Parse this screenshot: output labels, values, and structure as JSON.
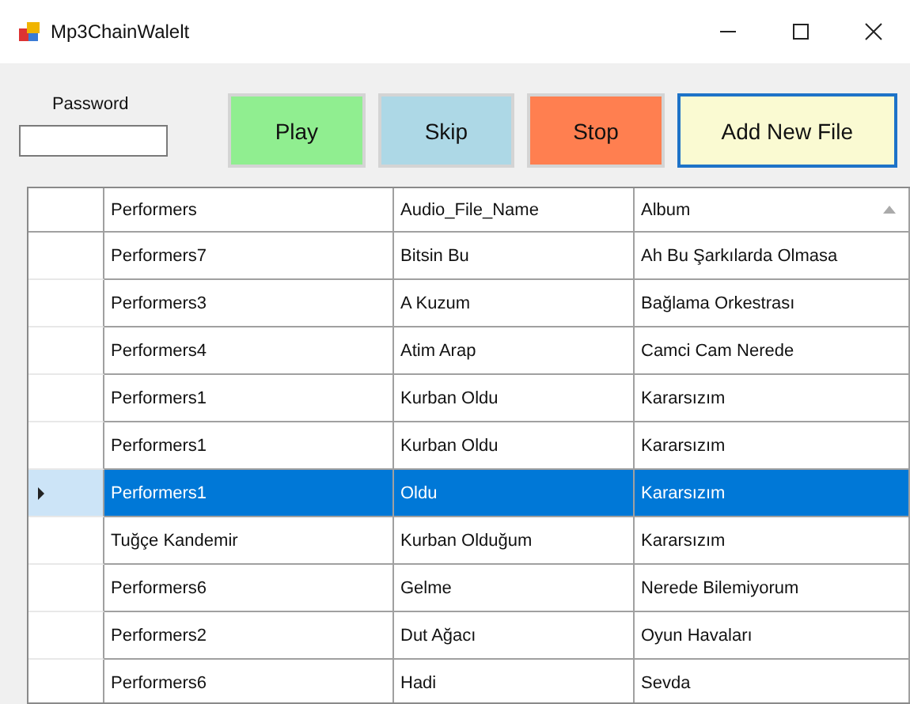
{
  "window": {
    "title": "Mp3ChainWalelt"
  },
  "password": {
    "label": "Password"
  },
  "buttons": [
    {
      "label": "Play",
      "color": "#90ee90",
      "focused": false
    },
    {
      "label": "Skip",
      "color": "#add8e6",
      "focused": false
    },
    {
      "label": "Stop",
      "color": "#ff7f50",
      "focused": false
    },
    {
      "label": "Add New File",
      "color": "#fafad2",
      "focused": true
    }
  ],
  "table": {
    "columns": [
      "Performers",
      "Audio_File_Name",
      "Album"
    ],
    "rows": [
      {
        "selected": false,
        "cells": [
          "Performers7",
          "Bitsin Bu",
          "Ah Bu Şarkılarda Olmasa"
        ]
      },
      {
        "selected": false,
        "cells": [
          "Performers3",
          "A Kuzum",
          "Bağlama Orkestrası"
        ]
      },
      {
        "selected": false,
        "cells": [
          "Performers4",
          "Atim Arap",
          "Camci Cam Nerede"
        ]
      },
      {
        "selected": false,
        "cells": [
          "Performers1",
          "Kurban Oldu",
          "Kararsızım"
        ]
      },
      {
        "selected": false,
        "cells": [
          "Performers1",
          "Kurban Oldu",
          "Kararsızım"
        ]
      },
      {
        "selected": true,
        "cells": [
          "Performers1",
          "Oldu",
          "Kararsızım"
        ]
      },
      {
        "selected": false,
        "cells": [
          "Tuğçe Kandemir",
          "Kurban Olduğum",
          "Kararsızım"
        ]
      },
      {
        "selected": false,
        "cells": [
          "Performers6",
          "Gelme",
          "Nerede Bilemiyorum"
        ]
      },
      {
        "selected": false,
        "cells": [
          "Performers2",
          "Dut Ağacı",
          "Oyun Havaları"
        ]
      },
      {
        "selected": false,
        "cells": [
          "Performers6",
          "Hadi",
          "Sevda"
        ]
      }
    ]
  }
}
